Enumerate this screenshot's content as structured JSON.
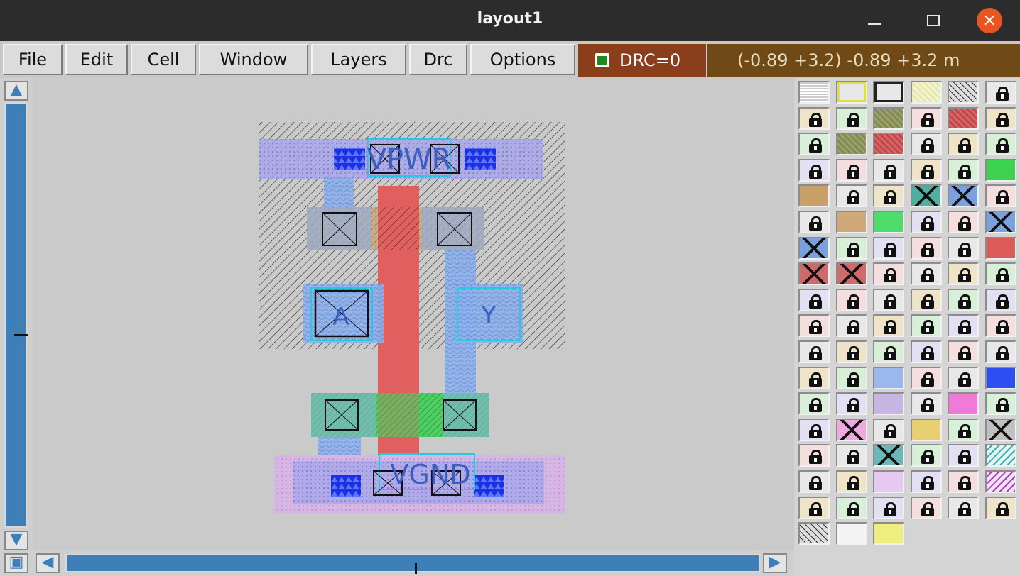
{
  "window": {
    "title": "layout1",
    "minimize_icon": "minimize-icon",
    "maximize_icon": "maximize-icon",
    "close_icon": "close-icon",
    "close_glyph": "×"
  },
  "menu": {
    "file": "File",
    "edit": "Edit",
    "cell": "Cell",
    "window": "Window",
    "layers": "Layers",
    "drc": "Drc",
    "options": "Options"
  },
  "status": {
    "drc_label": "DRC=0",
    "drc_checked": true,
    "coords": "(-0.89 +3.2) -0.89 +3.2 m"
  },
  "layout": {
    "labels": {
      "vpwr": "VPWR",
      "vgnd": "VGND",
      "a": "A",
      "y": "Y"
    }
  },
  "scroll": {
    "up_icon": "arrow-up-icon",
    "down_icon": "arrow-down-icon",
    "left_icon": "arrow-left-icon",
    "right_icon": "arrow-right-icon",
    "zoom_icon": "zoom-fit-icon",
    "up_glyph": "▲",
    "down_glyph": "▼",
    "left_glyph": "◀",
    "right_glyph": "▶",
    "zoom_glyph": "▣"
  },
  "palette": {
    "rows": [
      [
        "dots",
        "outline-yellow",
        "outline-black",
        "hatch-yellow",
        "hatch-black",
        "lock"
      ],
      [
        "lock",
        "lock",
        "hatch-olive",
        "lock",
        "hatch-red",
        "lock"
      ],
      [
        "lock",
        "hatch-olive",
        "hatch-red",
        "lock",
        "lock",
        "lock"
      ],
      [
        "lock",
        "lock",
        "lock",
        "lock",
        "lock",
        "solid-green"
      ],
      [
        "solid-tan",
        "lock",
        "lock",
        "cross-green",
        "cross-blue",
        "lock"
      ],
      [
        "lock",
        "dots-tan",
        "dots-green",
        "lock",
        "lock",
        "cross-blue"
      ],
      [
        "cross-blue",
        "lock",
        "lock",
        "lock",
        "lock",
        "solid-red"
      ],
      [
        "cross-red",
        "cross-red",
        "lock",
        "lock",
        "lock",
        "lock"
      ],
      [
        "lock",
        "lock",
        "lock",
        "lock",
        "lock",
        "lock"
      ],
      [
        "lock",
        "lock",
        "lock",
        "lock",
        "lock",
        "lock"
      ],
      [
        "lock",
        "lock",
        "lock",
        "lock",
        "lock",
        "lock"
      ],
      [
        "lock",
        "lock",
        "wave-blue",
        "lock",
        "lock",
        "tri-blue"
      ],
      [
        "lock",
        "lock",
        "solid-lavender",
        "lock",
        "dots-pink",
        "lock"
      ],
      [
        "lock",
        "cross-pink",
        "lock",
        "dots-yellow",
        "lock",
        "cross-gray"
      ],
      [
        "lock",
        "lock",
        "cross-teal",
        "lock",
        "lock",
        "hatch-teal"
      ],
      [
        "lock",
        "lock",
        "dots-purple",
        "lock",
        "lock",
        "hatch-purple"
      ],
      [
        "lock",
        "lock",
        "lock",
        "lock",
        "lock",
        "lock"
      ],
      [
        "hatch-black",
        "dots-white",
        "dots-yellow2"
      ]
    ]
  }
}
